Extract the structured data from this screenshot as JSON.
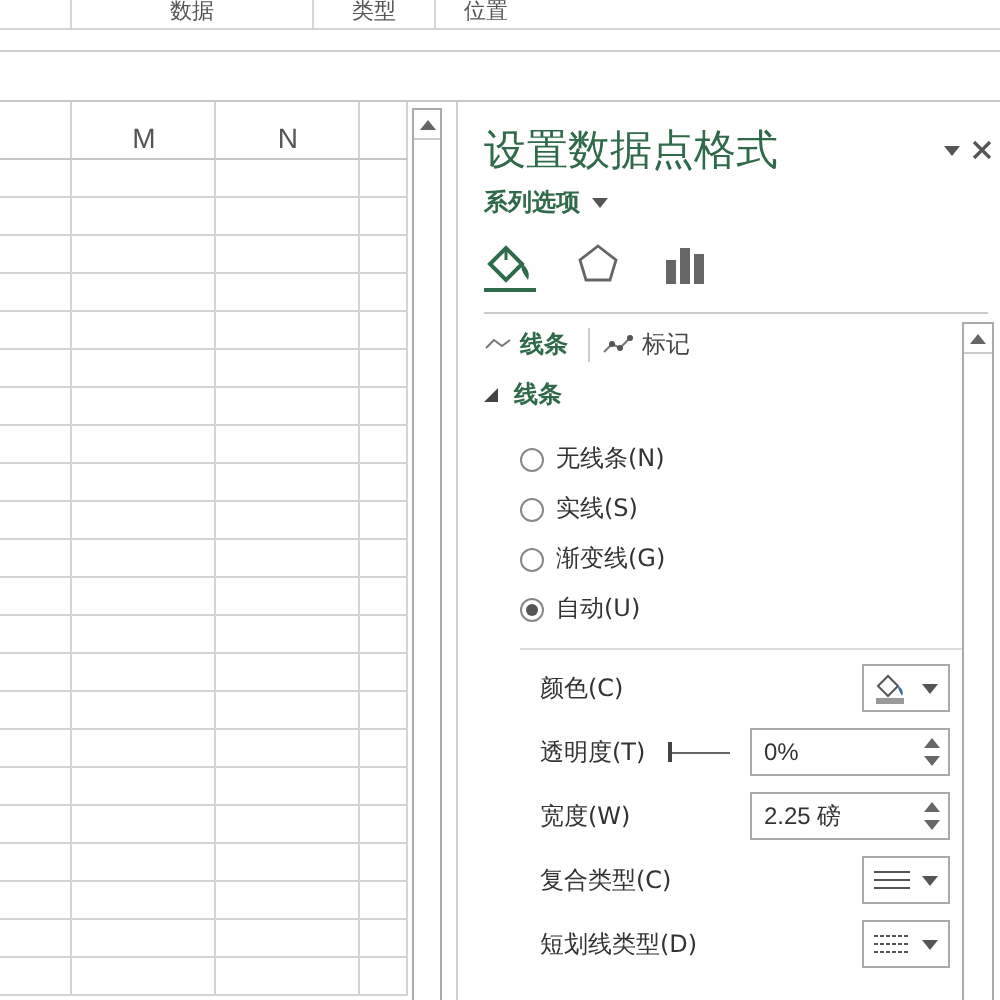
{
  "ribbon": {
    "groups": [
      "数据",
      "类型",
      "位置"
    ]
  },
  "sheet": {
    "columns": [
      "M",
      "N"
    ]
  },
  "pane": {
    "title": "设置数据点格式",
    "options_menu": "系列选项",
    "icon_tabs": [
      {
        "kind": "fill",
        "selected": true
      },
      {
        "kind": "effects",
        "selected": false
      },
      {
        "kind": "series",
        "selected": false
      }
    ],
    "tabs": [
      {
        "label": "线条",
        "kind": "line",
        "selected": true
      },
      {
        "label": "标记",
        "kind": "marker",
        "selected": false
      }
    ],
    "section": {
      "label": "线条",
      "expanded": true
    },
    "radios": [
      {
        "label": "无线条(N)",
        "selected": false
      },
      {
        "label": "实线(S)",
        "selected": false
      },
      {
        "label": "渐变线(G)",
        "selected": false
      },
      {
        "label": "自动(U)",
        "selected": true
      }
    ],
    "fields": [
      {
        "label": "颜色(C)",
        "kind": "color"
      },
      {
        "label": "透明度(T)",
        "kind": "slider",
        "level": 0,
        "value": "0%"
      },
      {
        "label": "宽度(W)",
        "kind": "spinner",
        "value": "2.25 磅"
      },
      {
        "label": "复合类型(C)",
        "kind": "compound"
      },
      {
        "label": "短划线类型(D)",
        "kind": "dash"
      }
    ]
  }
}
